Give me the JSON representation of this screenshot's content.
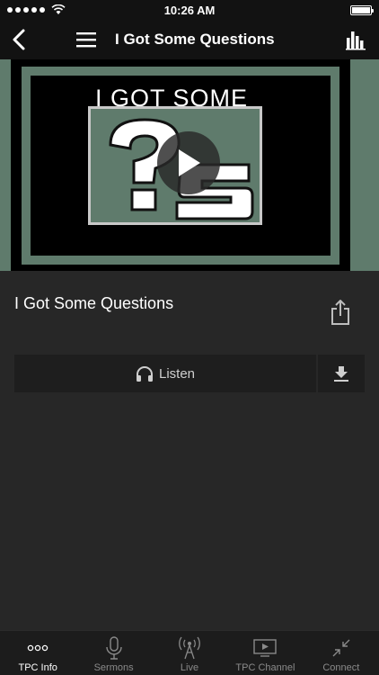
{
  "status_bar": {
    "time": "10:26 AM"
  },
  "nav": {
    "title": "I Got Some Questions"
  },
  "video": {
    "poster_heading": "I GOT SOME"
  },
  "sermon": {
    "title": "I Got Some Questions"
  },
  "actions": {
    "listen_label": "Listen"
  },
  "tabs": [
    {
      "label": "TPC Info",
      "icon": "more-dots-icon",
      "active": true
    },
    {
      "label": "Sermons",
      "icon": "microphone-icon",
      "active": false
    },
    {
      "label": "Live",
      "icon": "broadcast-tower-icon",
      "active": false
    },
    {
      "label": "TPC Channel",
      "icon": "video-player-icon",
      "active": false
    },
    {
      "label": "Connect",
      "icon": "collapse-arrows-icon",
      "active": false
    }
  ],
  "colors": {
    "accent": "#5f7b6c",
    "background": "#272727",
    "bar": "#121212"
  }
}
